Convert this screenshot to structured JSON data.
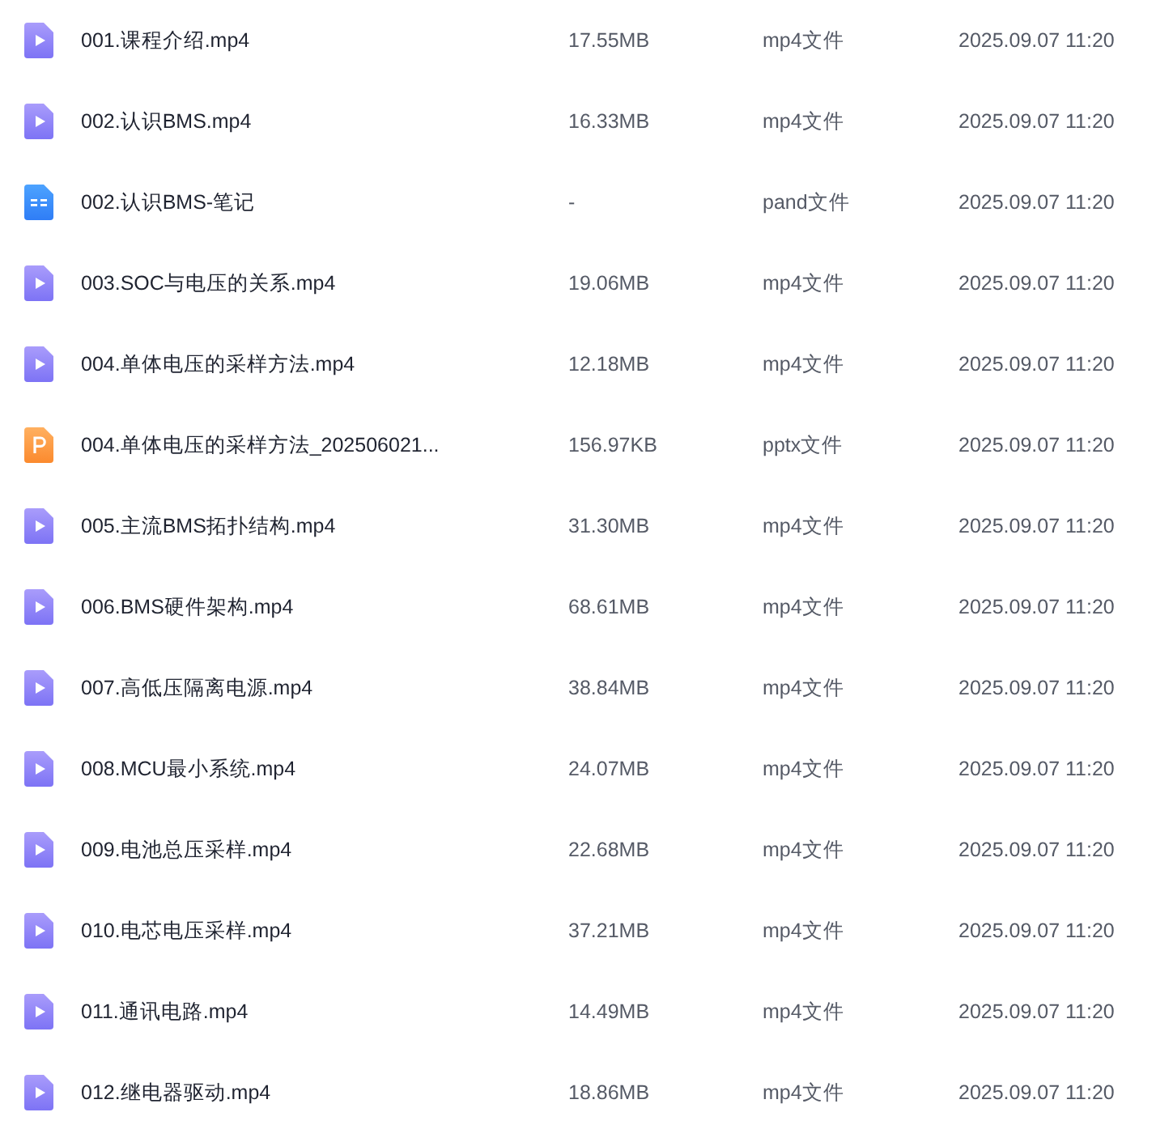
{
  "files": [
    {
      "kind": "video",
      "name": "001.课程介绍.mp4",
      "size": "17.55MB",
      "type": "mp4文件",
      "modified": "2025.09.07 11:20"
    },
    {
      "kind": "video",
      "name": "002.认识BMS.mp4",
      "size": "16.33MB",
      "type": "mp4文件",
      "modified": "2025.09.07 11:20"
    },
    {
      "kind": "note",
      "name": "002.认识BMS-笔记",
      "size": "-",
      "type": "pand文件",
      "modified": "2025.09.07 11:20"
    },
    {
      "kind": "video",
      "name": "003.SOC与电压的关系.mp4",
      "size": "19.06MB",
      "type": "mp4文件",
      "modified": "2025.09.07 11:20"
    },
    {
      "kind": "video",
      "name": "004.单体电压的采样方法.mp4",
      "size": "12.18MB",
      "type": "mp4文件",
      "modified": "2025.09.07 11:20"
    },
    {
      "kind": "slides",
      "name": "004.单体电压的采样方法_202506021...",
      "size": "156.97KB",
      "type": "pptx文件",
      "modified": "2025.09.07 11:20"
    },
    {
      "kind": "video",
      "name": "005.主流BMS拓扑结构.mp4",
      "size": "31.30MB",
      "type": "mp4文件",
      "modified": "2025.09.07 11:20"
    },
    {
      "kind": "video",
      "name": "006.BMS硬件架构.mp4",
      "size": "68.61MB",
      "type": "mp4文件",
      "modified": "2025.09.07 11:20"
    },
    {
      "kind": "video",
      "name": "007.高低压隔离电源.mp4",
      "size": "38.84MB",
      "type": "mp4文件",
      "modified": "2025.09.07 11:20"
    },
    {
      "kind": "video",
      "name": "008.MCU最小系统.mp4",
      "size": "24.07MB",
      "type": "mp4文件",
      "modified": "2025.09.07 11:20"
    },
    {
      "kind": "video",
      "name": "009.电池总压采样.mp4",
      "size": "22.68MB",
      "type": "mp4文件",
      "modified": "2025.09.07 11:20"
    },
    {
      "kind": "video",
      "name": "010.电芯电压采样.mp4",
      "size": "37.21MB",
      "type": "mp4文件",
      "modified": "2025.09.07 11:20"
    },
    {
      "kind": "video",
      "name": "011.通讯电路.mp4",
      "size": "14.49MB",
      "type": "mp4文件",
      "modified": "2025.09.07 11:20"
    },
    {
      "kind": "video",
      "name": "012.继电器驱动.mp4",
      "size": "18.86MB",
      "type": "mp4文件",
      "modified": "2025.09.07 11:20"
    }
  ]
}
